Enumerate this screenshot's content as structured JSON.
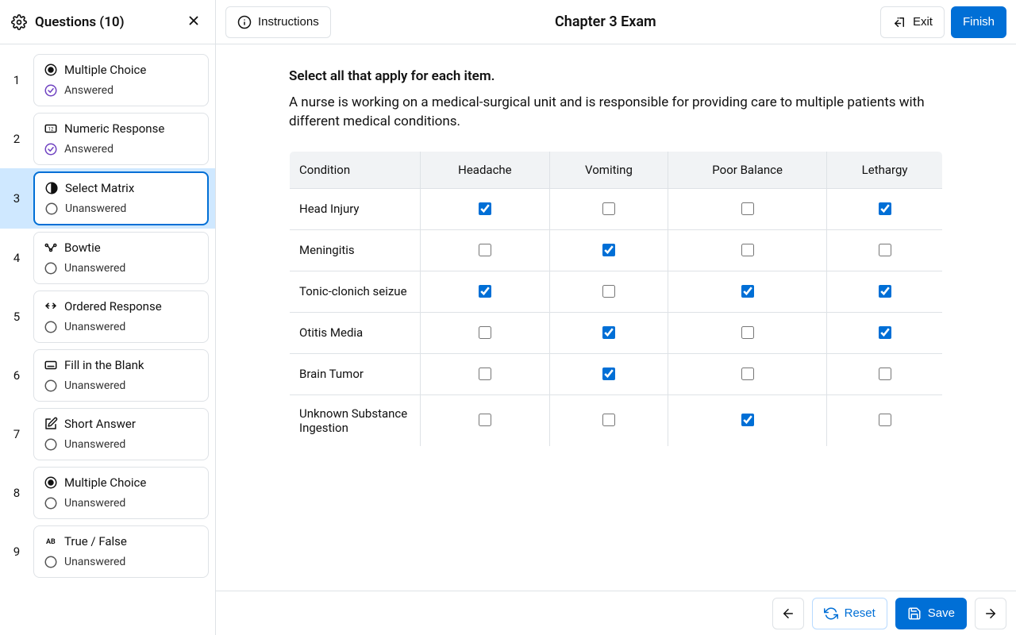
{
  "sidebar": {
    "title": "Questions (10)",
    "items": [
      {
        "num": "1",
        "type": "Multiple Choice",
        "status": "Answered",
        "answered": true,
        "icon": "radio"
      },
      {
        "num": "2",
        "type": "Numeric Response",
        "status": "Answered",
        "answered": true,
        "icon": "numeric"
      },
      {
        "num": "3",
        "type": "Select Matrix",
        "status": "Unanswered",
        "answered": false,
        "icon": "matrix",
        "active": true
      },
      {
        "num": "4",
        "type": "Bowtie",
        "status": "Unanswered",
        "answered": false,
        "icon": "bowtie"
      },
      {
        "num": "5",
        "type": "Ordered Response",
        "status": "Unanswered",
        "answered": false,
        "icon": "ordered"
      },
      {
        "num": "6",
        "type": "Fill in the Blank",
        "status": "Unanswered",
        "answered": false,
        "icon": "blank"
      },
      {
        "num": "7",
        "type": "Short Answer",
        "status": "Unanswered",
        "answered": false,
        "icon": "short"
      },
      {
        "num": "8",
        "type": "Multiple Choice",
        "status": "Unanswered",
        "answered": false,
        "icon": "radio"
      },
      {
        "num": "9",
        "type": "True / False",
        "status": "Unanswered",
        "answered": false,
        "icon": "tf"
      }
    ]
  },
  "header": {
    "instructions": "Instructions",
    "title": "Chapter 3 Exam",
    "exit": "Exit",
    "finish": "Finish"
  },
  "question": {
    "title": "Select all that apply for each item.",
    "body": "A nurse is working on a medical-surgical unit and is responsible for providing care to multiple patients with different medical conditions.",
    "matrix": {
      "row_header": "Condition",
      "columns": [
        "Headache",
        "Vomiting",
        "Poor Balance",
        "Lethargy"
      ],
      "rows": [
        {
          "label": "Head Injury",
          "checked": [
            true,
            false,
            false,
            true
          ]
        },
        {
          "label": "Meningitis",
          "checked": [
            false,
            true,
            false,
            false
          ]
        },
        {
          "label": "Tonic-clonich seizue",
          "checked": [
            true,
            false,
            true,
            true
          ]
        },
        {
          "label": "Otitis Media",
          "checked": [
            false,
            true,
            false,
            true
          ]
        },
        {
          "label": "Brain Tumor",
          "checked": [
            false,
            true,
            false,
            false
          ]
        },
        {
          "label": "Unknown Substance Ingestion",
          "checked": [
            false,
            false,
            true,
            false
          ]
        }
      ]
    }
  },
  "footer": {
    "reset": "Reset",
    "save": "Save"
  }
}
